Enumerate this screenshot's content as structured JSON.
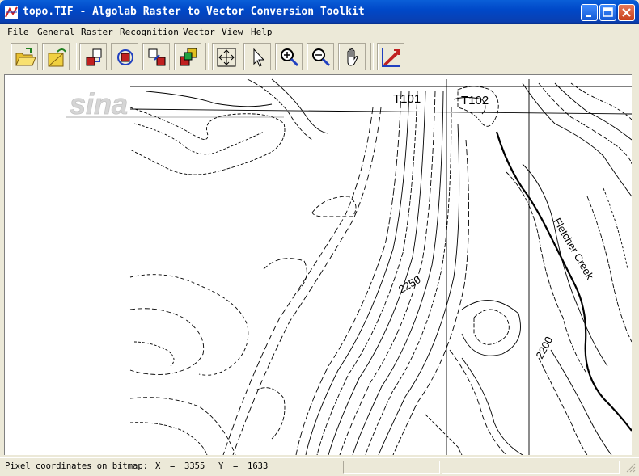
{
  "window": {
    "title": "topo.TIF - Algolab Raster to Vector Conversion Toolkit"
  },
  "menu": {
    "items": [
      {
        "label": "File"
      },
      {
        "label": "General"
      },
      {
        "label": "Raster"
      },
      {
        "label": "Recognition"
      },
      {
        "label": "Vector"
      },
      {
        "label": "View"
      },
      {
        "label": "Help"
      }
    ]
  },
  "toolbar": {
    "buttons": [
      {
        "icon": "open-folder-icon"
      },
      {
        "icon": "save-raster-icon"
      },
      {
        "icon": "raster-edit-icon"
      },
      {
        "icon": "raster-rotate-icon"
      },
      {
        "icon": "raster-combine-icon"
      },
      {
        "icon": "raster-layers-icon"
      },
      {
        "icon": "fit-to-window-icon"
      },
      {
        "icon": "select-arrow-icon"
      },
      {
        "icon": "zoom-in-icon"
      },
      {
        "icon": "zoom-out-icon"
      },
      {
        "icon": "pan-hand-icon"
      },
      {
        "icon": "vectorize-icon"
      }
    ]
  },
  "map": {
    "labels": {
      "t101": "T101",
      "t102": "T102",
      "c2250": "2250",
      "c2200": "2200",
      "creek": "Fletcher Creek"
    },
    "watermark": "sina"
  },
  "status": {
    "label": "Pixel coordinates on bitmap:",
    "x_label": "X",
    "x_value": "3355",
    "y_label": "Y",
    "y_value": "1633",
    "eq": "="
  },
  "colors": {
    "title_bar": "#0a4fd0",
    "close_button": "#d7502c",
    "map_lines": "#000000",
    "window_face": "#ece9d8"
  }
}
